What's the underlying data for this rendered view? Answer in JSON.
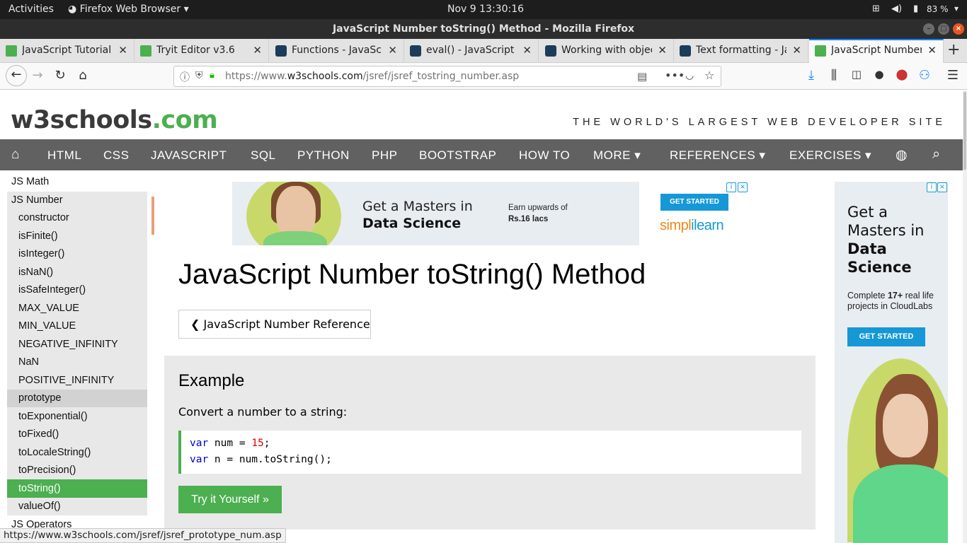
{
  "system_bar": {
    "activities": "Activities",
    "app_name": "Firefox Web Browser",
    "clock": "Nov 9  13:30:16",
    "battery": "83 %"
  },
  "window": {
    "title": "JavaScript Number toString() Method - Mozilla Firefox"
  },
  "tabs": [
    {
      "label": "JavaScript Tutorial",
      "icon": "w3schools-favicon"
    },
    {
      "label": "Tryit Editor v3.6",
      "icon": "w3schools-favicon"
    },
    {
      "label": "Functions - JavaScript",
      "icon": "mdn-favicon"
    },
    {
      "label": "eval() - JavaScript | MDN",
      "icon": "mdn-favicon"
    },
    {
      "label": "Working with objects",
      "icon": "mdn-favicon"
    },
    {
      "label": "Text formatting - JavaScript",
      "icon": "mdn-favicon"
    },
    {
      "label": "JavaScript Number toString",
      "icon": "w3schools-favicon",
      "active": true
    }
  ],
  "navbar": {
    "url_prefix": "https://www.",
    "url_domain": "w3schools.com",
    "url_path": "/jsref/jsref_tostring_number.asp"
  },
  "site": {
    "logo_main": "w3schools",
    "logo_tld": ".com",
    "tagline": "THE WORLD'S LARGEST WEB DEVELOPER SITE",
    "topnav": [
      "HTML",
      "CSS",
      "JAVASCRIPT",
      "SQL",
      "PYTHON",
      "PHP",
      "BOOTSTRAP",
      "HOW TO",
      "MORE ▾",
      "REFERENCES ▾",
      "EXERCISES ▾"
    ]
  },
  "sidebar": {
    "head_before": "JS Math",
    "head_current": "JS Number",
    "items": [
      "constructor",
      "isFinite()",
      "isInteger()",
      "isNaN()",
      "isSafeInteger()",
      "MAX_VALUE",
      "MIN_VALUE",
      "NEGATIVE_INFINITY",
      "NaN",
      "POSITIVE_INFINITY",
      "prototype",
      "toExponential()",
      "toFixed()",
      "toLocaleString()",
      "toPrecision()",
      "toString()",
      "valueOf()"
    ],
    "head_after": "JS Operators",
    "selected": "toString()",
    "hovered": "prototype"
  },
  "ad_banner": {
    "headline_1": "Get a Masters in",
    "headline_2": "Data Science",
    "earn_1": "Earn upwards of",
    "earn_2": "Rs.16 lacs",
    "cta": "GET STARTED",
    "brand_1": "simpl",
    "brand_2": "i",
    "brand_3": "learn"
  },
  "main": {
    "title": "JavaScript Number toString() Method",
    "ref_button": "❮ JavaScript Number Reference",
    "example_heading": "Example",
    "example_desc": "Convert a number to a string:",
    "code_line1": {
      "kw": "var",
      "rest": " num = ",
      "num": "15",
      "end": ";"
    },
    "code_line2": {
      "kw": "var",
      "rest": " n = num.toString();"
    },
    "try_button": "Try it Yourself »"
  },
  "side_ad": {
    "h1": "Get a",
    "h2": "Masters in",
    "h3": "Data",
    "h4": "Science",
    "sub_1": "Complete ",
    "sub_bold": "17+",
    "sub_2": " real life",
    "sub_3": "projects in CloudLabs",
    "cta": "GET STARTED"
  },
  "status_url": "https://www.w3schools.com/jsref/jsref_prototype_num.asp",
  "colors": {
    "brand_green": "#4caf50",
    "nav_gray": "#616161",
    "accent_blue": "#0a84ff"
  }
}
